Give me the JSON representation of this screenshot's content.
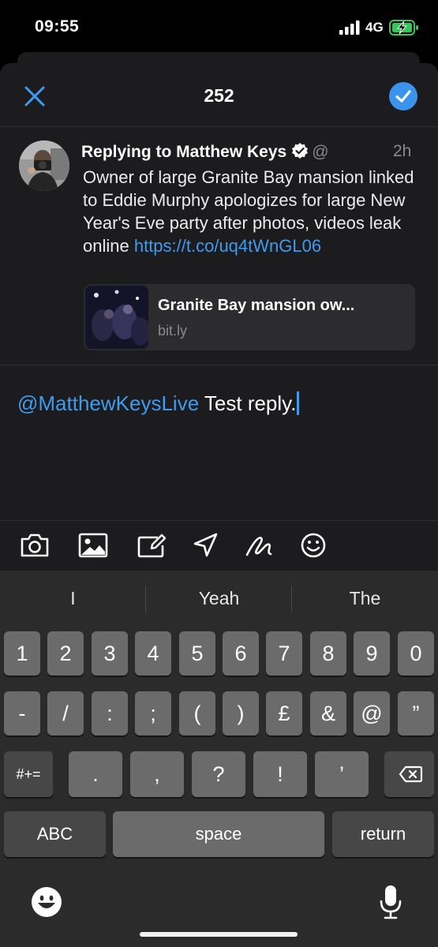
{
  "status_bar": {
    "time": "09:55",
    "network": "4G"
  },
  "header": {
    "char_count": "252"
  },
  "reply": {
    "label": "Replying to Matthew Keys",
    "handle_fragment": "@",
    "time": "2h",
    "body_text": "Owner of large Granite Bay mansion linked to Eddie Murphy apologizes for large New Year's Eve party after photos, videos leak online ",
    "body_link": "https://t.co/uq4tWnGL06",
    "card": {
      "title": "Granite Bay mansion ow...",
      "domain": "bit.ly"
    }
  },
  "compose": {
    "mention": "@MatthewKeysLive",
    "text": " Test reply."
  },
  "toolbar": {
    "icons": [
      "camera-icon",
      "image-icon",
      "gif-icon",
      "location-icon",
      "draw-icon",
      "emoji-icon"
    ]
  },
  "keyboard": {
    "predictions": [
      "I",
      "Yeah",
      "The"
    ],
    "row1": [
      "1",
      "2",
      "3",
      "4",
      "5",
      "6",
      "7",
      "8",
      "9",
      "0"
    ],
    "row2": [
      "-",
      "/",
      ":",
      ";",
      "(",
      ")",
      "£",
      "&",
      "@",
      "”"
    ],
    "row3": {
      "mode": "#+=",
      "keys": [
        ".",
        ",",
        "?",
        "!",
        "’"
      ]
    },
    "row4": {
      "abc": "ABC",
      "space": "space",
      "return": "return"
    }
  },
  "colors": {
    "accent": "#3d9bf0",
    "sheet_bg": "#1c1c1e",
    "keyboard_bg": "#2b2b2b"
  }
}
